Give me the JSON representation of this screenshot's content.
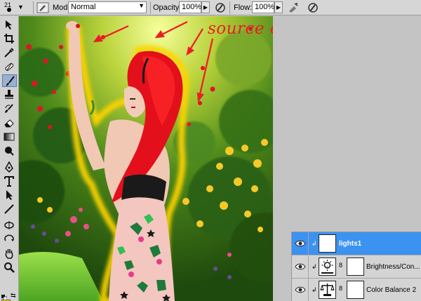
{
  "options_bar": {
    "brush_size": "21",
    "mode_label": "Mode:",
    "mode_value": "Normal",
    "opacity_label": "Opacity:",
    "opacity_value": "100%",
    "flow_label": "Flow:",
    "flow_value": "100%"
  },
  "toolbox": {
    "tools": [
      "move",
      "crop",
      "eyedropper",
      "healing-brush",
      "brush",
      "clone-stamp",
      "history-brush",
      "eraser",
      "gradient",
      "burn",
      "pen",
      "type",
      "path-selection",
      "line",
      "3d-rotate",
      "3d-orbit",
      "hand",
      "zoom"
    ],
    "active_tool": "brush",
    "foreground_color": "#ffea00",
    "background_color": "#ffffff"
  },
  "canvas": {
    "annotation_text": "source of the light",
    "annotation_color": "#ee1c24",
    "glow_color": "#ffd700"
  },
  "layers": [
    {
      "name": "lights1",
      "type": "pixel",
      "selected": true
    },
    {
      "name": "Brightness/Con...",
      "type": "adjustment-brightness",
      "selected": false
    },
    {
      "name": "Color Balance 2",
      "type": "adjustment-color-balance",
      "selected": false
    }
  ],
  "colors": {
    "selected_layer": "#3b92f0",
    "panel": "#d4d4d4",
    "workspace": "#c4c4c4"
  }
}
